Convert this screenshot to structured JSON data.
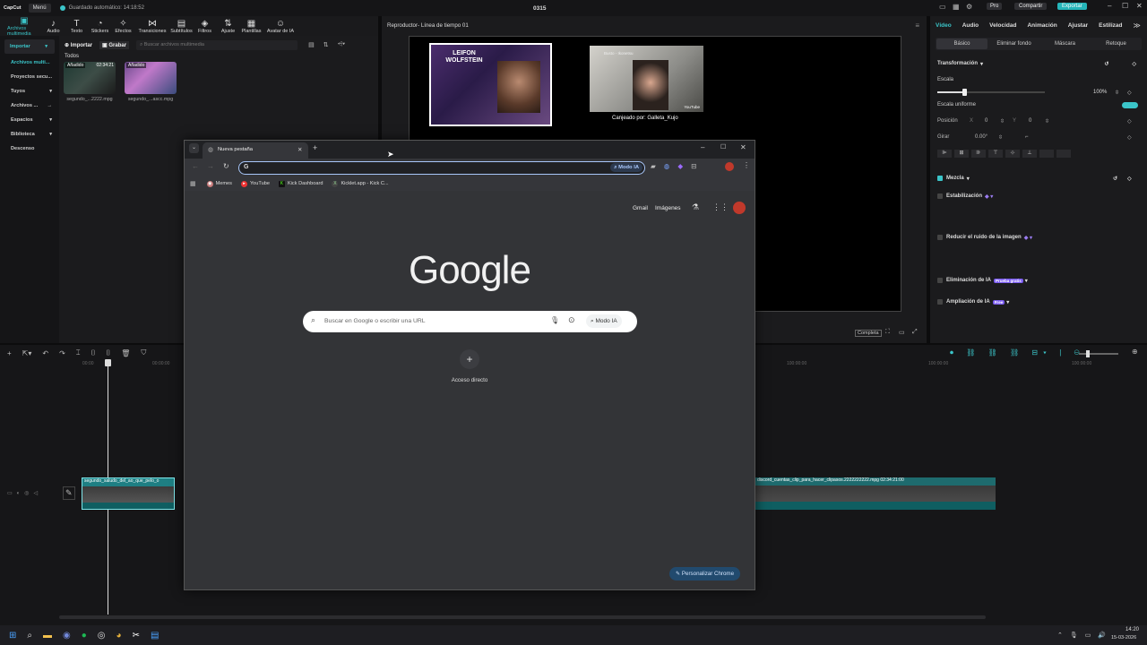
{
  "app": {
    "logo": "CapCut",
    "menu": "Menú",
    "autosave": "Guardado automático: 14:18:52",
    "project": "0315",
    "pro": "Pro",
    "share": "Compartir",
    "export": "Exportar"
  },
  "toolbar": [
    {
      "label": "Archivos multimedia",
      "icon": "media-icon",
      "glyph": "▣",
      "active": true
    },
    {
      "label": "Audio",
      "icon": "audio-icon",
      "glyph": "♪"
    },
    {
      "label": "Texto",
      "icon": "text-icon",
      "glyph": "T"
    },
    {
      "label": "Stickers",
      "icon": "sticker-icon",
      "glyph": "◔"
    },
    {
      "label": "Efectos",
      "icon": "effects-icon",
      "glyph": "✧"
    },
    {
      "label": "Transiciones",
      "icon": "transition-icon",
      "glyph": "⋈"
    },
    {
      "label": "Subtítulos",
      "icon": "subtitles-icon",
      "glyph": "▤"
    },
    {
      "label": "Filtros",
      "icon": "filters-icon",
      "glyph": "◈"
    },
    {
      "label": "Ajuste",
      "icon": "adjust-icon",
      "glyph": "⇅"
    },
    {
      "label": "Plantillas",
      "icon": "templates-icon",
      "glyph": "▦"
    },
    {
      "label": "Avatar de IA",
      "icon": "avatar-icon",
      "glyph": "☺"
    }
  ],
  "leftnav": [
    {
      "label": "Importar",
      "arrow": "▾",
      "active": true
    },
    {
      "label": "Archivos multi...",
      "active": true
    },
    {
      "label": "Proyectos secu..."
    },
    {
      "label": "Tuyos",
      "arrow": "▾"
    },
    {
      "label": "Archivos ...",
      "arrow": "→"
    },
    {
      "label": "Espacios",
      "arrow": "▾"
    },
    {
      "label": "Biblioteca",
      "arrow": "▾"
    },
    {
      "label": "Descenso"
    }
  ],
  "media": {
    "import": "Importar",
    "record": "Grabar",
    "search_placeholder": "Buscar archivos multimedia",
    "filter": "Todos",
    "items": [
      {
        "badge": "Añadido",
        "duration": "02:34:21",
        "name": "segundo_...2222.mpg"
      },
      {
        "badge": "Añadido",
        "duration": "",
        "name": "segundo_...ascc.mpg"
      }
    ]
  },
  "player": {
    "title": "Reproductor- Línea de tiempo 01",
    "full_btn": "Completa",
    "streamer_name": "LEIFON WOLFSTEIN",
    "cam_label": "Canjeado por: Galleta_Kujo",
    "video_caption": "Busto - Ikonetsu",
    "yt": "YouTube"
  },
  "props": {
    "tabs": [
      "Vídeo",
      "Audio",
      "Velocidad",
      "Animación",
      "Ajustar",
      "Estilizad"
    ],
    "subtabs": [
      "Básico",
      "Eliminar fondo",
      "Máscara",
      "Retoque"
    ],
    "transform": "Transformación",
    "scale": "Escala",
    "scale_val": "100%",
    "uniform": "Escala uniforme",
    "position": "Posición",
    "pos_x_label": "X",
    "pos_x": "0",
    "pos_y_label": "Y",
    "pos_y": "0",
    "rotate": "Girar",
    "rotate_val": "0.00°",
    "blend": "Mezcla",
    "stabilize": "Estabilización",
    "denoise": "Reducir el ruido de la imagen",
    "ai_remove": "Eliminación de IA",
    "ai_badge": "Prueba gratis",
    "ai_expand": "Ampliación de IA",
    "free_badge": "Free"
  },
  "timeline": {
    "clip1": "segundo_saludo_del_ao_que_pelo_o",
    "clip2": "discord_cuentas_clip_para_hacer_clipasos.2222222222.mpg  02:34:21:00",
    "t0": "00:00",
    "t1": "00:00:00",
    "t2": "100:00:00",
    "t3": "100:00:00",
    "t4": "100:00:00"
  },
  "chrome": {
    "tab_title": "Nueva pestaña",
    "omnibox_letter": "G",
    "ai_mode": "Modo IA",
    "bookmarks": [
      "Memes",
      "YouTube",
      "Kick Dashboard",
      "Kicklet.app - Kick C..."
    ],
    "gmail": "Gmail",
    "images": "Imágenes",
    "logo": "Google",
    "search_placeholder": "Buscar en Google o escribir una URL",
    "search_ai": "Modo IA",
    "shortcut": "Acceso directo",
    "customize": "Personalizar Chrome"
  },
  "taskbar": {
    "time": "14:20",
    "date": "15-03-2026"
  }
}
